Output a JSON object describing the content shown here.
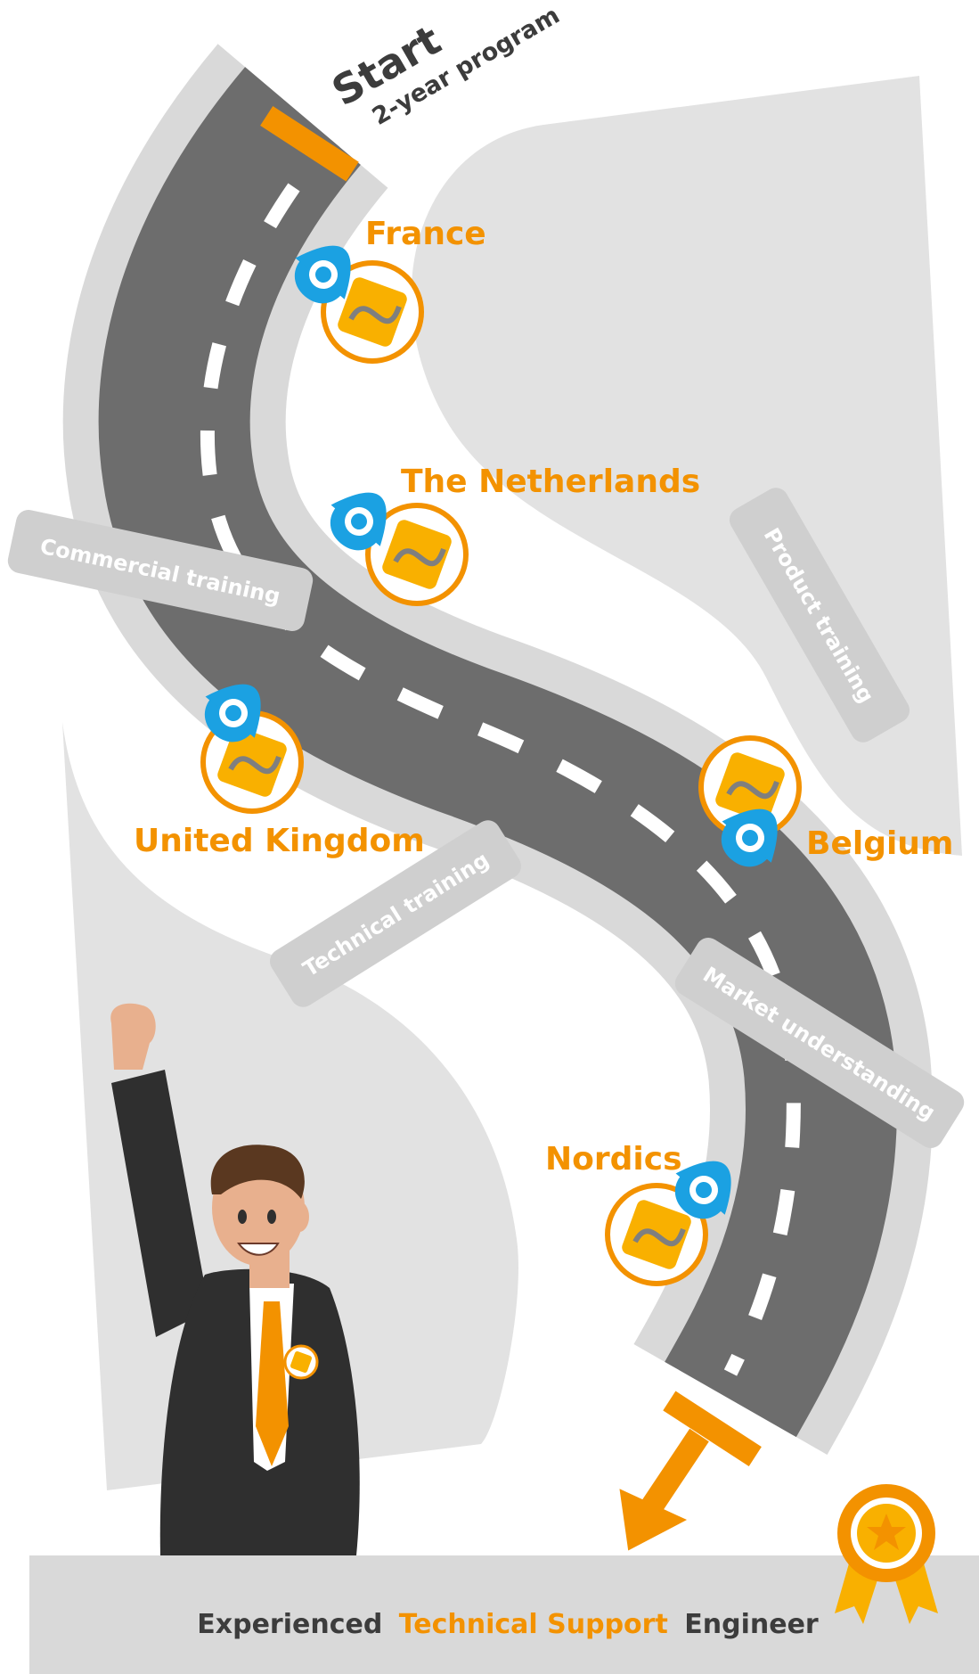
{
  "start": {
    "title": "Start",
    "subtitle": "2-year program"
  },
  "locations": [
    {
      "name": "France"
    },
    {
      "name": "The Netherlands"
    },
    {
      "name": "United Kingdom"
    },
    {
      "name": "Belgium"
    },
    {
      "name": "Nordics"
    }
  ],
  "trainings": [
    {
      "label": "Commercial training"
    },
    {
      "label": "Product training"
    },
    {
      "label": "Technical training"
    },
    {
      "label": "Market understanding"
    }
  ],
  "result": {
    "prefix": "Experienced",
    "highlight": "Technical Support",
    "suffix": "Engineer"
  },
  "colors": {
    "accent": "#F39200",
    "road": "#6D6D6D",
    "road_edge": "#D9D9D9",
    "pin": "#1BA1E2",
    "pill": "#CFCFCF",
    "dark_text": "#3C3C3C",
    "bar": "#D9D9D9"
  },
  "icons": {
    "pin": "location-pin-icon",
    "logo": "company-logo-icon",
    "award": "award-ribbon-icon",
    "arrow": "down-arrow-icon"
  }
}
